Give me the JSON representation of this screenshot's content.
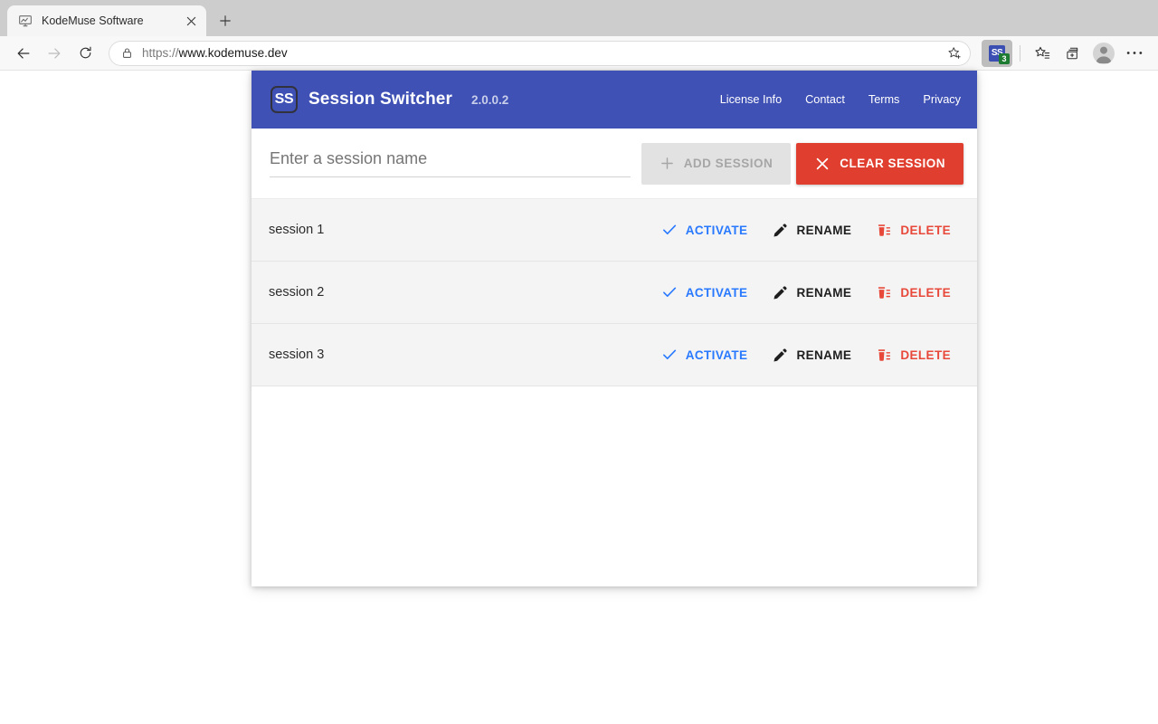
{
  "browser": {
    "tab": {
      "title": "KodeMuse Software",
      "favicon_icon": "monitor-icon",
      "close_icon": "close-icon"
    },
    "new_tab_icon": "plus-icon",
    "nav": {
      "back_icon": "back-arrow-icon",
      "forward_icon": "forward-arrow-icon",
      "reload_icon": "reload-icon"
    },
    "omnibox": {
      "lock_icon": "lock-icon",
      "scheme": "https://",
      "host": "www.kodemuse.dev",
      "favorite_icon": "star-plus-icon"
    },
    "extension": {
      "label": "SS",
      "badge": "3",
      "badge_color": "#1e7b32",
      "icon_color": "#3b4fb3"
    },
    "toolbar_icons": {
      "favorites_icon": "favorites-list-icon",
      "collections_icon": "collections-icon",
      "profile_icon": "profile-avatar-icon",
      "settings_icon": "more-options-icon"
    }
  },
  "app": {
    "header": {
      "logo_text": "SS",
      "title": "Session Switcher",
      "version": "2.0.0.2",
      "background_color": "#3f51b5",
      "nav_links": [
        {
          "label": "License Info"
        },
        {
          "label": "Contact"
        },
        {
          "label": "Terms"
        },
        {
          "label": "Privacy"
        }
      ]
    },
    "form": {
      "input": {
        "value": "",
        "placeholder": "Enter a session name"
      },
      "add_button": {
        "label": "ADD SESSION",
        "icon": "plus-icon",
        "disabled": true
      },
      "clear_button": {
        "label": "CLEAR SESSION",
        "icon": "close-x-icon",
        "color": "#e03e2f"
      }
    },
    "row_actions": {
      "activate_label": "ACTIVATE",
      "activate_icon": "check-icon",
      "activate_color": "#2979ff",
      "rename_label": "RENAME",
      "rename_icon": "pencil-icon",
      "rename_color": "#1e1e1e",
      "delete_label": "DELETE",
      "delete_icon": "delete-sweep-icon",
      "delete_color": "#e8483a"
    },
    "sessions": [
      {
        "name": "session 1"
      },
      {
        "name": "session 2"
      },
      {
        "name": "session 3"
      }
    ]
  }
}
